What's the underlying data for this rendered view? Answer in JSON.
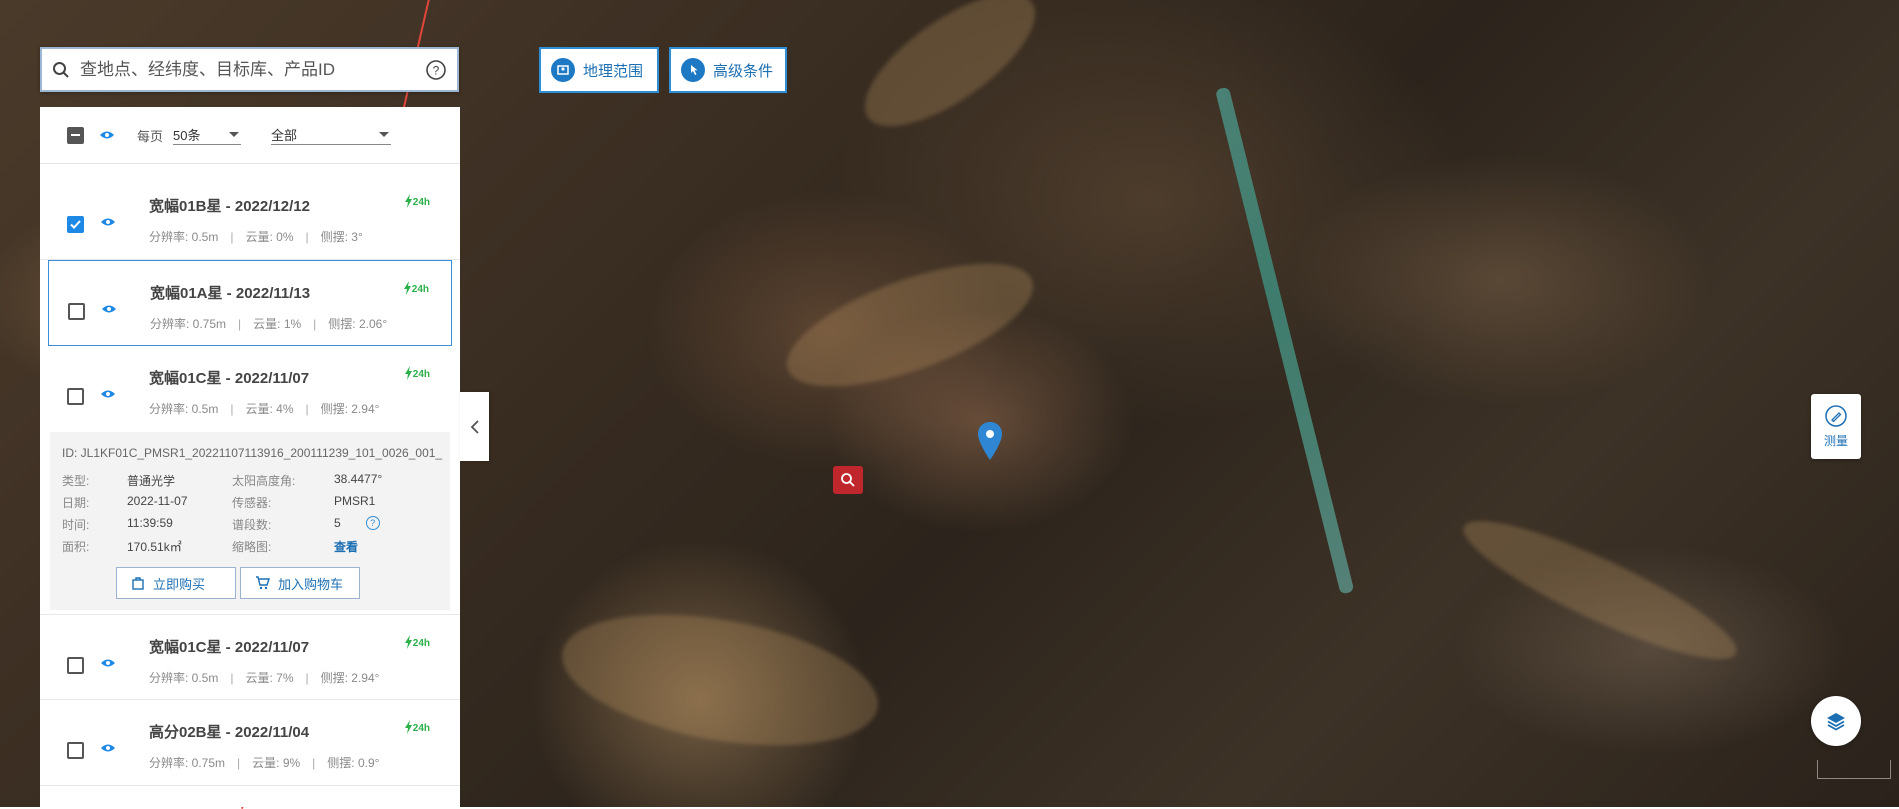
{
  "search": {
    "placeholder": "查地点、经纬度、目标库、产品ID"
  },
  "top_buttons": {
    "geo_range": "地理范围",
    "advanced": "高级条件"
  },
  "list_header": {
    "per_page_label": "每页",
    "per_page_value": "50条",
    "filter_value": "全部"
  },
  "items": [
    {
      "title": "宽幅01B星 - 2022/12/12",
      "resolution": "分辨率: 0.5m",
      "cloud": "云量: 0%",
      "tilt": "侧摆: 3°",
      "checked": true,
      "badge": "24h"
    },
    {
      "title": "宽幅01A星 - 2022/11/13",
      "resolution": "分辨率: 0.75m",
      "cloud": "云量: 1%",
      "tilt": "侧摆: 2.06°",
      "checked": false,
      "badge": "24h"
    },
    {
      "title": "宽幅01C星 - 2022/11/07",
      "resolution": "分辨率: 0.5m",
      "cloud": "云量: 4%",
      "tilt": "侧摆: 2.94°",
      "checked": false,
      "badge": "24h"
    },
    {
      "title": "宽幅01C星 - 2022/11/07",
      "resolution": "分辨率: 0.5m",
      "cloud": "云量: 7%",
      "tilt": "侧摆: 2.94°",
      "checked": false,
      "badge": "24h"
    },
    {
      "title": "高分02B星 - 2022/11/04",
      "resolution": "分辨率: 0.75m",
      "cloud": "云量: 9%",
      "tilt": "侧摆: 0.9°",
      "checked": false,
      "badge": "24h"
    }
  ],
  "detail": {
    "id": "ID:  JL1KF01C_PMSR1_20221107113916_200111239_101_0026_001_",
    "type_label": "类型:",
    "type_value": "普通光学",
    "sun_label": "太阳高度角:",
    "sun_value": "38.4477°",
    "date_label": "日期:",
    "date_value": "2022-11-07",
    "sensor_label": "传感器:",
    "sensor_value": "PMSR1",
    "time_label": "时间:",
    "time_value": "11:39:59",
    "bands_label": "谱段数:",
    "bands_value": "5",
    "area_label": "面积:",
    "area_value": "170.51k㎡",
    "thumb_label": "缩略图:",
    "thumb_link": "查看",
    "buy_now": "立即购买",
    "add_cart": "加入购物车"
  },
  "map_tools": {
    "measure": "测量"
  },
  "colors": {
    "accent": "#1d6fb3",
    "badge_green": "#2bb04a",
    "marker_red": "#c0272d",
    "pin_blue": "#2f86d3"
  }
}
